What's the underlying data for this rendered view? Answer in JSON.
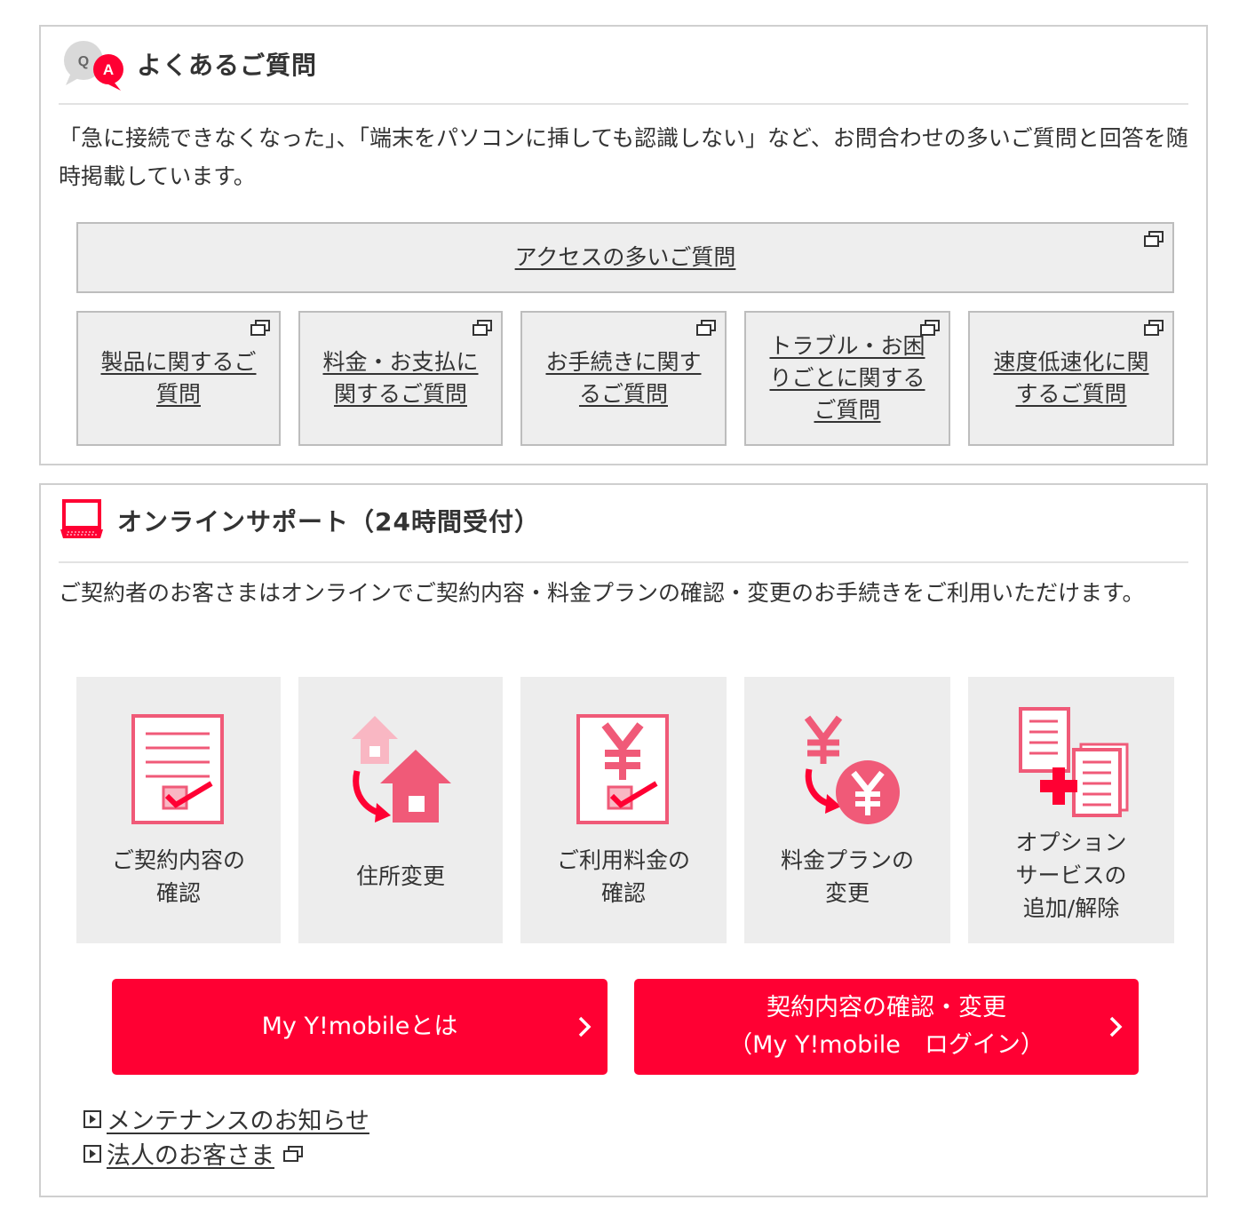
{
  "faq": {
    "title": "よくあるご質問",
    "icon": "qa-icon",
    "description": "「急に接続できなくなった」、「端末をパソコンに挿しても認識しない」など、お問合わせの多いご質問と回答を随時掲載しています。",
    "main_button": "アクセスの多いご質問",
    "category_buttons": [
      "製品に関するご質問",
      "料金・お支払に関するご質問",
      "お手続きに関するご質問",
      "トラブル・お困りごとに関するご質問",
      "速度低速化に関するご質問"
    ]
  },
  "online_support": {
    "title": "オンラインサポート（24時間受付）",
    "icon": "laptop-icon",
    "description": "ご契約者のお客さまはオンラインでご契約内容・料金プランの確認・変更のお手続きをご利用いただけます。",
    "tiles": [
      {
        "label": "ご契約内容の\n確認",
        "icon": "contract-check-icon"
      },
      {
        "label": "住所変更",
        "icon": "address-change-icon"
      },
      {
        "label": "ご利用料金の\n確認",
        "icon": "bill-check-icon"
      },
      {
        "label": "料金プランの\n変更",
        "icon": "plan-change-icon"
      },
      {
        "label": "オプション\nサービスの\n追加/解除",
        "icon": "option-service-icon"
      }
    ],
    "buttons": {
      "about_label": "My Y!mobileとは",
      "login_label": "契約内容の確認・変更\n（My Y!mobile　ログイン）"
    },
    "links": [
      "メンテナンスのお知らせ",
      "法人のお客さま"
    ]
  },
  "colors": {
    "accent": "#ff0033",
    "icon_pink": "#f05a78",
    "icon_light_pink": "#f9b7c3",
    "panel_border": "#cfcfcf",
    "tile_bg": "#ededed",
    "text": "#333333"
  }
}
